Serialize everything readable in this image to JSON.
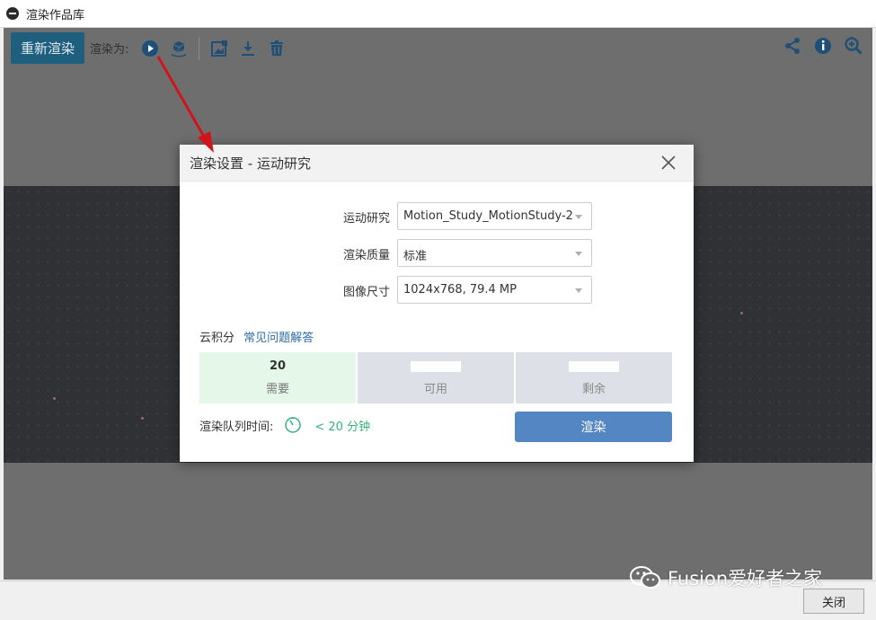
{
  "window": {
    "title": "渲染作品库"
  },
  "toolbar": {
    "rerender_label": "重新渲染",
    "render_as_label": "渲染为:",
    "left_icons": [
      "play-circle-icon",
      "cube-hand-icon",
      "edit-image-icon",
      "download-icon",
      "trash-icon"
    ],
    "right_icons": [
      "share-icon",
      "info-icon",
      "zoom-in-icon"
    ]
  },
  "dialog": {
    "title": "渲染设置 - 运动研究",
    "fields": [
      {
        "label": "运动研究",
        "value": "Motion_Study_MotionStudy-2"
      },
      {
        "label": "渲染质量",
        "value": "标准"
      },
      {
        "label": "图像尺寸",
        "value": "1024x768, 79.4 MP"
      }
    ],
    "cloud_credits_label": "云积分",
    "faq_link": "常见问题解答",
    "credits": [
      {
        "value": "20",
        "caption": "需要"
      },
      {
        "value": "",
        "caption": "可用"
      },
      {
        "value": "",
        "caption": "剩余"
      }
    ],
    "queue_time_label": "渲染队列时间:",
    "queue_time_value": "< 20 分钟",
    "render_button": "渲染"
  },
  "footer": {
    "close_button": "关闭"
  },
  "watermark": {
    "text": "Fusion爱好者之家"
  },
  "colors": {
    "accent": "#5486c4",
    "toolbar_icon": "#1f4f77",
    "rerender_button": "#1f5f7e",
    "link": "#2f6ca8",
    "success": "#33b37a",
    "annotation_arrow": "#d0141b"
  }
}
